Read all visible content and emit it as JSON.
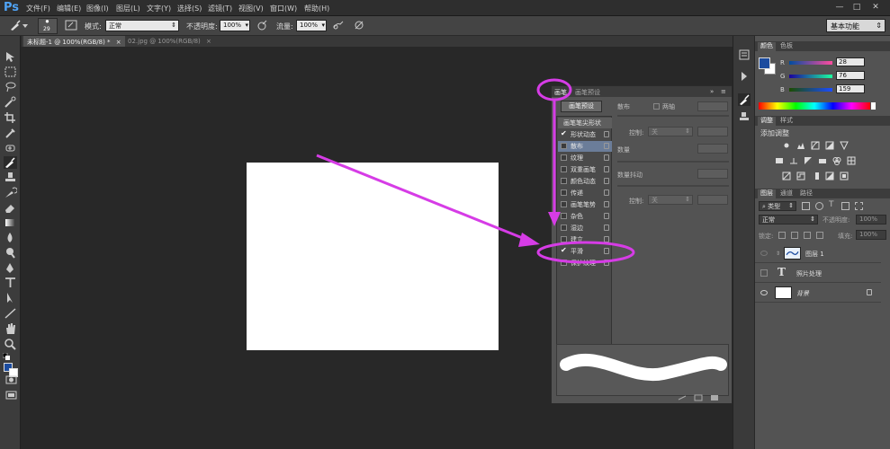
{
  "app": {
    "logo": "Ps"
  },
  "menu": [
    "文件(F)",
    "编辑(E)",
    "图像(I)",
    "图层(L)",
    "文字(Y)",
    "选择(S)",
    "滤镜(T)",
    "视图(V)",
    "窗口(W)",
    "帮助(H)"
  ],
  "window_controls": {
    "minimize": "—",
    "maximize": "□",
    "close": "✕"
  },
  "options_bar": {
    "brush_size": "29",
    "mode_label": "模式:",
    "mode_value": "正常",
    "opacity_label": "不透明度:",
    "opacity_value": "100%",
    "flow_label": "流量:",
    "flow_value": "100%",
    "workspace": "基本功能"
  },
  "doc_tabs": [
    {
      "label": "未标题-1 @ 100%(RGB/8) *",
      "close": "×"
    },
    {
      "label": "02.jpg @ 100%(RGB/8)",
      "close": "×"
    }
  ],
  "brush_panel": {
    "tabs": [
      "画笔",
      "画笔预设"
    ],
    "preset_button": "画笔预设",
    "settings": [
      "画笔笔尖形状",
      "形状动态",
      "散布",
      "纹理",
      "双重画笔",
      "颜色动态",
      "传递",
      "画笔笔势",
      "杂色",
      "湿边",
      "建立",
      "平滑",
      "保护纹理"
    ],
    "checked": [
      "形状动态",
      "平滑"
    ],
    "highlighted": "散布",
    "right": {
      "scatter_label": "散布",
      "both_axes": "两轴",
      "control_label": "控制:",
      "control_value": "关",
      "count_label": "数量",
      "count_jitter_label": "数量抖动",
      "control2_label": "控制:",
      "control2_value": "关"
    }
  },
  "panels": {
    "color": {
      "tabs": [
        "颜色",
        "色板"
      ],
      "channels": [
        {
          "name": "R",
          "value": "28"
        },
        {
          "name": "G",
          "value": "76"
        },
        {
          "name": "B",
          "value": "159"
        }
      ],
      "fg_color": "#1c4c9f"
    },
    "adjustments": {
      "tabs": [
        "调整",
        "样式"
      ],
      "title": "添加调整"
    },
    "layers": {
      "tabs": [
        "图层",
        "通道",
        "路径"
      ],
      "filter_label": "类型",
      "blend_mode": "正常",
      "opacity_label": "不透明度:",
      "opacity_value": "100%",
      "lock_label": "锁定:",
      "fill_label": "填充:",
      "fill_value": "100%",
      "layers": [
        {
          "name": "图层 1"
        },
        {
          "name": "照片处理"
        },
        {
          "name": "背景"
        }
      ]
    }
  },
  "annotation_color": "#d63ce6"
}
